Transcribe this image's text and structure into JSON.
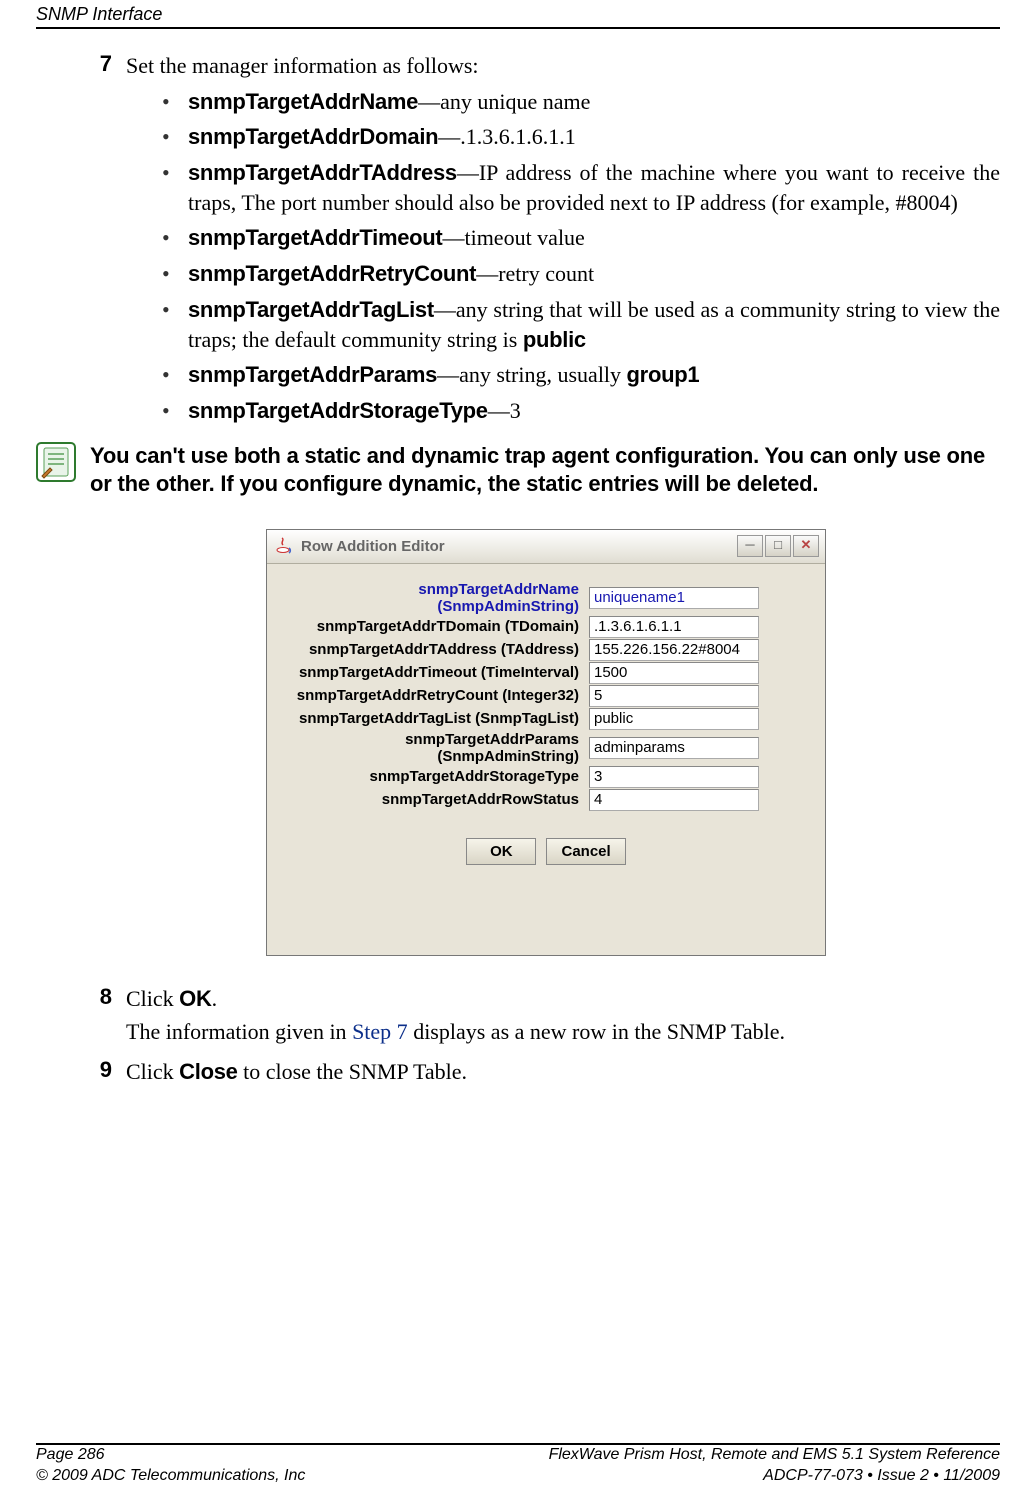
{
  "header": {
    "section": "SNMP Interface"
  },
  "step7": {
    "num": "7",
    "intro": "Set the manager information as follows:",
    "items": [
      {
        "field": "snmpTargetAddrName",
        "desc": "—any unique name"
      },
      {
        "field": "snmpTargetAddrDomain",
        "desc": "—.1.3.6.1.6.1.1"
      },
      {
        "field": "snmpTargetAddrTAddress",
        "desc": "—IP address of the machine where you want to receive the traps, The port number should also be provided next to IP address (for example, #8004)"
      },
      {
        "field": "snmpTargetAddrTimeout",
        "desc": "—timeout value"
      },
      {
        "field": "snmpTargetAddrRetryCount",
        "desc": "—retry count"
      },
      {
        "field": "snmpTargetAddrTagList",
        "desc_a": "—any string that will be used as a community string to view the traps; the default community string is ",
        "code": "public"
      },
      {
        "field": "snmpTargetAddrParams",
        "desc_a": "—any string, usually ",
        "code": "group1"
      },
      {
        "field": "snmpTargetAddrStorageType",
        "desc": "—3"
      }
    ]
  },
  "note": "You can't use both a static and dynamic trap agent configuration. You can only use one or the other. If you configure dynamic, the static entries will be deleted.",
  "dialog": {
    "title": "Row Addition  Editor",
    "rows": [
      {
        "label": "snmpTargetAddrName (SnmpAdminString)",
        "value": "uniquename1"
      },
      {
        "label": "snmpTargetAddrTDomain (TDomain)",
        "value": ".1.3.6.1.6.1.1"
      },
      {
        "label": "snmpTargetAddrTAddress (TAddress)",
        "value": "155.226.156.22#8004"
      },
      {
        "label": "snmpTargetAddrTimeout (TimeInterval)",
        "value": "1500"
      },
      {
        "label": "snmpTargetAddrRetryCount (Integer32)",
        "value": "5"
      },
      {
        "label": "snmpTargetAddrTagList (SnmpTagList)",
        "value": "public"
      },
      {
        "label": "snmpTargetAddrParams (SnmpAdminString)",
        "value": "adminparams"
      },
      {
        "label": "snmpTargetAddrStorageType",
        "value": "3"
      },
      {
        "label": "snmpTargetAddrRowStatus",
        "value": "4"
      }
    ],
    "ok": "OK",
    "cancel": "Cancel"
  },
  "step8": {
    "num": "8",
    "line1a": "Click ",
    "line1b": "OK",
    "line1c": ".",
    "line2a": "The information given in ",
    "line2link": "Step 7",
    "line2b": " displays as a new row in the SNMP Table."
  },
  "step9": {
    "num": "9",
    "a": "Click ",
    "b": "Close",
    "c": " to close the SNMP Table."
  },
  "footer": {
    "l1": "Page 286",
    "r1": "FlexWave Prism Host, Remote and EMS 5.1 System Reference",
    "l2": "© 2009 ADC Telecommunications, Inc",
    "r2": "ADCP-77-073 • Issue 2 • 11/2009"
  }
}
